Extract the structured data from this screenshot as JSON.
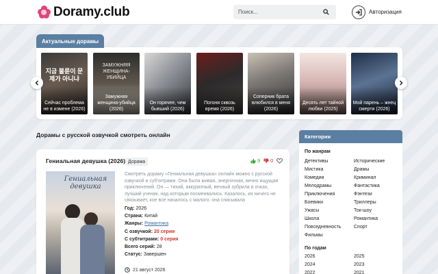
{
  "header": {
    "logo_text": "Doramy.club",
    "search_placeholder": "Поиск...",
    "login_label": "Авторизация"
  },
  "carousel": {
    "tab_label": "Актуальные дорамы",
    "items": [
      {
        "title": "Сейчас проблема не в измене (2026)",
        "poster_text": "지금 불륜이 문제가 아니냐"
      },
      {
        "title": "Замужняя женщина-убийца (2026)",
        "poster_text": "ЗАМУЖНЯЯ ЖЕНЩИНА-УБИЙЦА"
      },
      {
        "title": "Он горячее, чем бывший (2026)",
        "poster_text": ""
      },
      {
        "title": "Погоня сквозь время (2026)",
        "poster_text": ""
      },
      {
        "title": "Соперник брата влюбился в меня (2026)",
        "poster_text": ""
      },
      {
        "title": "Десять лет тайной любви (2025)",
        "poster_text": ""
      },
      {
        "title": "Мой парень – жнец смерти (2026)",
        "poster_text": ""
      }
    ]
  },
  "section_title": "Дорамы с русской озвучкой смотреть онлайн",
  "post": {
    "title": "Гениальная девушка (2026)",
    "badge": "Дорама",
    "likes": "9",
    "dislikes": "0",
    "poster_text": "Гениальная девушка",
    "description": "Смотреть дораму «Гениальная девушка» онлайн можно с русской озвучкой и субтитрами. Она была живая, энергичная, вечно ищущая приключений. Он — тихий, аккуратный, вечный зубрила в очках, лучший ученик, над которым посмеивались. Казалось, их ничего не связывает, кое все началось с малого: она списывала",
    "info": {
      "year_label": "Год:",
      "year": "2026",
      "country_label": "Страна:",
      "country": "Китай",
      "genres_label": "Жанры:",
      "genres": "Романтика",
      "dub_label": "С озвучкой:",
      "dub": "20 серия",
      "subs_label": "С субтитрами:",
      "subs": "0 серия",
      "total_label": "Всего серий:",
      "total": "28",
      "status_label": "Статус:",
      "status": "Завершен"
    },
    "date": "21 август 2026"
  },
  "sidebar": {
    "header": "Категории",
    "genres_title": "По жанрам",
    "genres_left": [
      "Детективы",
      "Мистика",
      "Комедии",
      "Мелодрамы",
      "Приключения",
      "Боевики",
      "Ужасы",
      "Школа",
      "Повседневность",
      "Фильмы"
    ],
    "genres_right": [
      "Исторические",
      "Драмы",
      "Криминал",
      "Фантастика",
      "Фэнтези",
      "Триллеры",
      "Ток-шоу",
      "Романтика",
      "Спорт"
    ],
    "years_title": "По годам",
    "years_left": [
      "2026",
      "2024",
      "2022"
    ],
    "years_right": [
      "2025",
      "2023",
      "2021"
    ]
  },
  "colors": {
    "accent": "#5a7fa2",
    "logo_pink": "#e0457b",
    "like_green": "#3aa43a",
    "dislike_red": "#d23a3a"
  }
}
